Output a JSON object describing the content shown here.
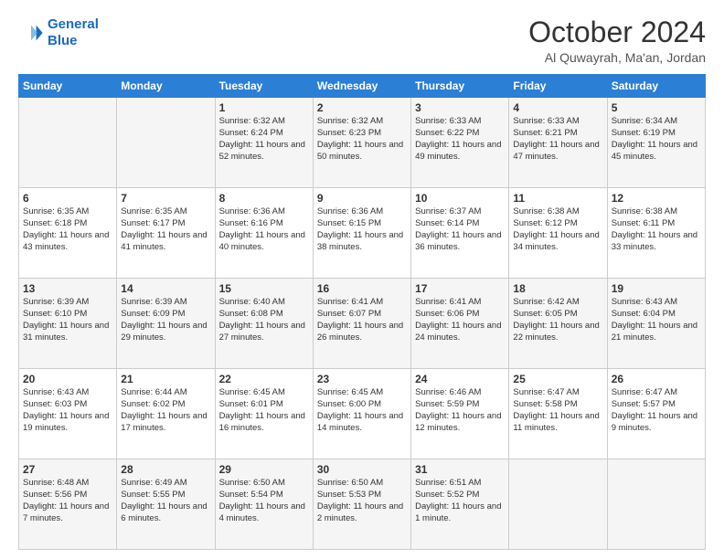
{
  "logo": {
    "line1": "General",
    "line2": "Blue"
  },
  "header": {
    "month": "October 2024",
    "location": "Al Quwayrah, Ma'an, Jordan"
  },
  "weekdays": [
    "Sunday",
    "Monday",
    "Tuesday",
    "Wednesday",
    "Thursday",
    "Friday",
    "Saturday"
  ],
  "weeks": [
    [
      {
        "day": "",
        "info": ""
      },
      {
        "day": "",
        "info": ""
      },
      {
        "day": "1",
        "info": "Sunrise: 6:32 AM\nSunset: 6:24 PM\nDaylight: 11 hours and 52 minutes."
      },
      {
        "day": "2",
        "info": "Sunrise: 6:32 AM\nSunset: 6:23 PM\nDaylight: 11 hours and 50 minutes."
      },
      {
        "day": "3",
        "info": "Sunrise: 6:33 AM\nSunset: 6:22 PM\nDaylight: 11 hours and 49 minutes."
      },
      {
        "day": "4",
        "info": "Sunrise: 6:33 AM\nSunset: 6:21 PM\nDaylight: 11 hours and 47 minutes."
      },
      {
        "day": "5",
        "info": "Sunrise: 6:34 AM\nSunset: 6:19 PM\nDaylight: 11 hours and 45 minutes."
      }
    ],
    [
      {
        "day": "6",
        "info": "Sunrise: 6:35 AM\nSunset: 6:18 PM\nDaylight: 11 hours and 43 minutes."
      },
      {
        "day": "7",
        "info": "Sunrise: 6:35 AM\nSunset: 6:17 PM\nDaylight: 11 hours and 41 minutes."
      },
      {
        "day": "8",
        "info": "Sunrise: 6:36 AM\nSunset: 6:16 PM\nDaylight: 11 hours and 40 minutes."
      },
      {
        "day": "9",
        "info": "Sunrise: 6:36 AM\nSunset: 6:15 PM\nDaylight: 11 hours and 38 minutes."
      },
      {
        "day": "10",
        "info": "Sunrise: 6:37 AM\nSunset: 6:14 PM\nDaylight: 11 hours and 36 minutes."
      },
      {
        "day": "11",
        "info": "Sunrise: 6:38 AM\nSunset: 6:12 PM\nDaylight: 11 hours and 34 minutes."
      },
      {
        "day": "12",
        "info": "Sunrise: 6:38 AM\nSunset: 6:11 PM\nDaylight: 11 hours and 33 minutes."
      }
    ],
    [
      {
        "day": "13",
        "info": "Sunrise: 6:39 AM\nSunset: 6:10 PM\nDaylight: 11 hours and 31 minutes."
      },
      {
        "day": "14",
        "info": "Sunrise: 6:39 AM\nSunset: 6:09 PM\nDaylight: 11 hours and 29 minutes."
      },
      {
        "day": "15",
        "info": "Sunrise: 6:40 AM\nSunset: 6:08 PM\nDaylight: 11 hours and 27 minutes."
      },
      {
        "day": "16",
        "info": "Sunrise: 6:41 AM\nSunset: 6:07 PM\nDaylight: 11 hours and 26 minutes."
      },
      {
        "day": "17",
        "info": "Sunrise: 6:41 AM\nSunset: 6:06 PM\nDaylight: 11 hours and 24 minutes."
      },
      {
        "day": "18",
        "info": "Sunrise: 6:42 AM\nSunset: 6:05 PM\nDaylight: 11 hours and 22 minutes."
      },
      {
        "day": "19",
        "info": "Sunrise: 6:43 AM\nSunset: 6:04 PM\nDaylight: 11 hours and 21 minutes."
      }
    ],
    [
      {
        "day": "20",
        "info": "Sunrise: 6:43 AM\nSunset: 6:03 PM\nDaylight: 11 hours and 19 minutes."
      },
      {
        "day": "21",
        "info": "Sunrise: 6:44 AM\nSunset: 6:02 PM\nDaylight: 11 hours and 17 minutes."
      },
      {
        "day": "22",
        "info": "Sunrise: 6:45 AM\nSunset: 6:01 PM\nDaylight: 11 hours and 16 minutes."
      },
      {
        "day": "23",
        "info": "Sunrise: 6:45 AM\nSunset: 6:00 PM\nDaylight: 11 hours and 14 minutes."
      },
      {
        "day": "24",
        "info": "Sunrise: 6:46 AM\nSunset: 5:59 PM\nDaylight: 11 hours and 12 minutes."
      },
      {
        "day": "25",
        "info": "Sunrise: 6:47 AM\nSunset: 5:58 PM\nDaylight: 11 hours and 11 minutes."
      },
      {
        "day": "26",
        "info": "Sunrise: 6:47 AM\nSunset: 5:57 PM\nDaylight: 11 hours and 9 minutes."
      }
    ],
    [
      {
        "day": "27",
        "info": "Sunrise: 6:48 AM\nSunset: 5:56 PM\nDaylight: 11 hours and 7 minutes."
      },
      {
        "day": "28",
        "info": "Sunrise: 6:49 AM\nSunset: 5:55 PM\nDaylight: 11 hours and 6 minutes."
      },
      {
        "day": "29",
        "info": "Sunrise: 6:50 AM\nSunset: 5:54 PM\nDaylight: 11 hours and 4 minutes."
      },
      {
        "day": "30",
        "info": "Sunrise: 6:50 AM\nSunset: 5:53 PM\nDaylight: 11 hours and 2 minutes."
      },
      {
        "day": "31",
        "info": "Sunrise: 6:51 AM\nSunset: 5:52 PM\nDaylight: 11 hours and 1 minute."
      },
      {
        "day": "",
        "info": ""
      },
      {
        "day": "",
        "info": ""
      }
    ]
  ]
}
